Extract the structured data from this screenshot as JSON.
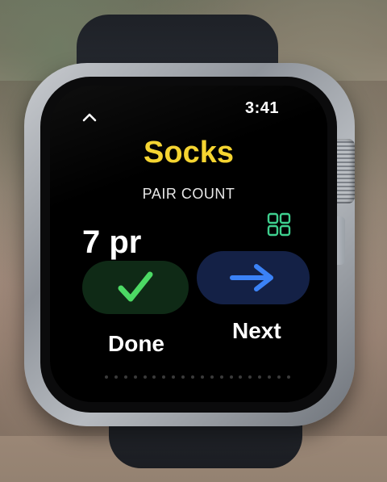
{
  "status": {
    "time": "3:41"
  },
  "header": {
    "title": "Socks",
    "subtitle": "PAIR COUNT"
  },
  "main": {
    "count": "7 pr"
  },
  "actions": {
    "done": {
      "label": "Done",
      "icon": "checkmark-icon",
      "color": "#4cd964"
    },
    "next": {
      "label": "Next",
      "icon": "arrow-right-icon",
      "color": "#3b82f6"
    }
  },
  "icons": {
    "back": "chevron-up-icon",
    "grid": "grid-icon"
  },
  "colors": {
    "title": "#f5d430",
    "grid_icon": "#3ecf8e",
    "done_pill": "#0f2a16",
    "next_pill": "#142146"
  }
}
